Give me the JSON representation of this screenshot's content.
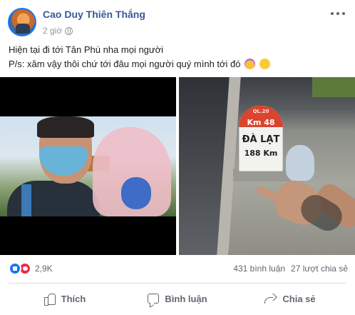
{
  "post": {
    "author": "Cao Duy Thiên Thắng",
    "time": "2 giờ",
    "privacy_icon": "globe-icon",
    "text_line1": "Hiện tại đi tới Tân Phú nha mọi người",
    "text_line2": "P/s: xăm vậy thôi chứ tới đâu mọi người quý mình tới đó",
    "emojis": [
      "smiling-face-with-horns-icon",
      "smiling-face-with-hearts-icon"
    ]
  },
  "photo_right": {
    "road_code": "QL.20",
    "km": "Km 48",
    "city": "ĐÀ LẠT",
    "distance": "188 Km"
  },
  "stats": {
    "reaction_icons": [
      "like-reaction-icon",
      "love-reaction-icon"
    ],
    "reactions": "2,9K",
    "comments": "431 bình luận",
    "shares": "27 lượt chia sẻ"
  },
  "actions": {
    "like": "Thích",
    "comment": "Bình luận",
    "share": "Chia sẻ"
  },
  "colors": {
    "author": "#385898",
    "like_reaction": "#1877f2",
    "love_reaction": "#f0284a",
    "milestone_top": "#d9452f"
  }
}
